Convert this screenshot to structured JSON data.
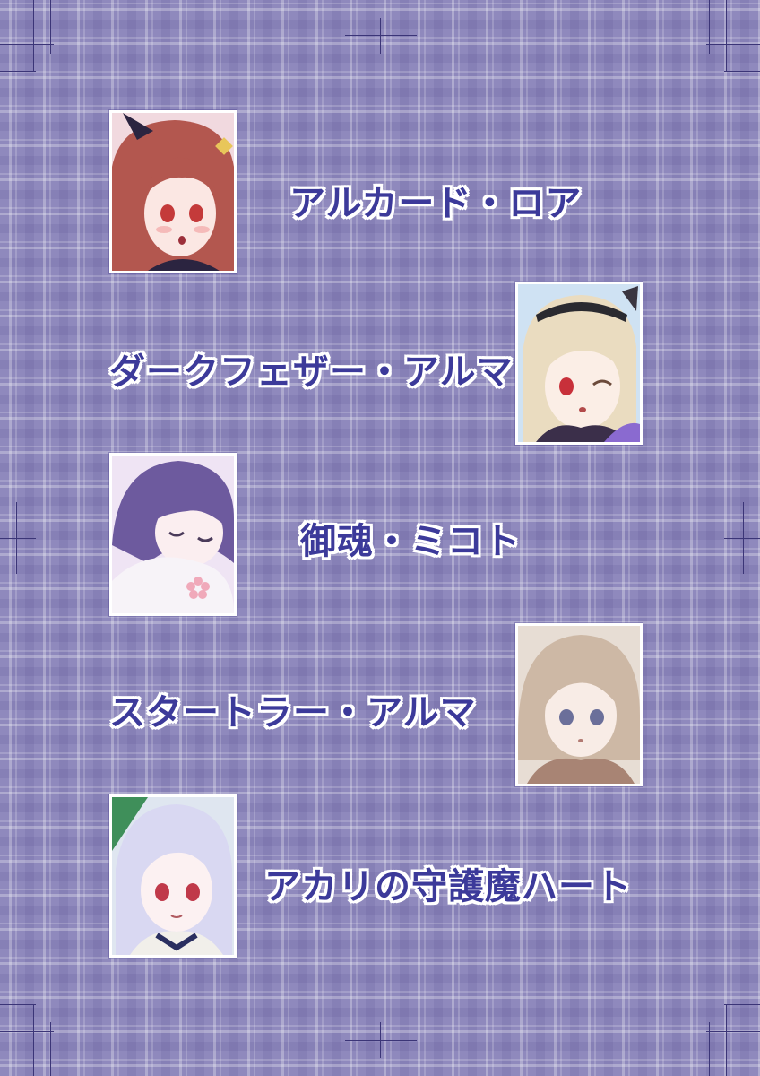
{
  "characters": [
    {
      "name": "アルカード・ロア",
      "portrait": "red-haired-girl-blushing",
      "hair_color": "#b3574f",
      "eye_color": "#c43a3a",
      "bg_color": "#f1d9df"
    },
    {
      "name": "ダークフェザー・アルマ",
      "portrait": "blonde-girl-winking",
      "hair_color": "#eadcc0",
      "eye_color": "#c8303a",
      "bg_color": "#cfe2f3"
    },
    {
      "name": "御魂・ミコト",
      "portrait": "purple-haired-girl-sleeping",
      "hair_color": "#6d5a9e",
      "eye_color": "#6d5a9e",
      "bg_color": "#efe4f4"
    },
    {
      "name": "スタートラー・アルマ",
      "portrait": "light-brown-haired-girl",
      "hair_color": "#cdb8a5",
      "eye_color": "#6b6f9a",
      "bg_color": "#e7ddd4"
    },
    {
      "name": "アカリの守護魔ハート",
      "portrait": "silver-haired-girl",
      "hair_color": "#d9d8f2",
      "eye_color": "#c0394a",
      "bg_color": "#dfe6f0"
    }
  ],
  "colors": {
    "text": "#3c3a9a",
    "text_outline": "#ffffff",
    "frame": "#ffffff",
    "background": "#8f89bd"
  }
}
